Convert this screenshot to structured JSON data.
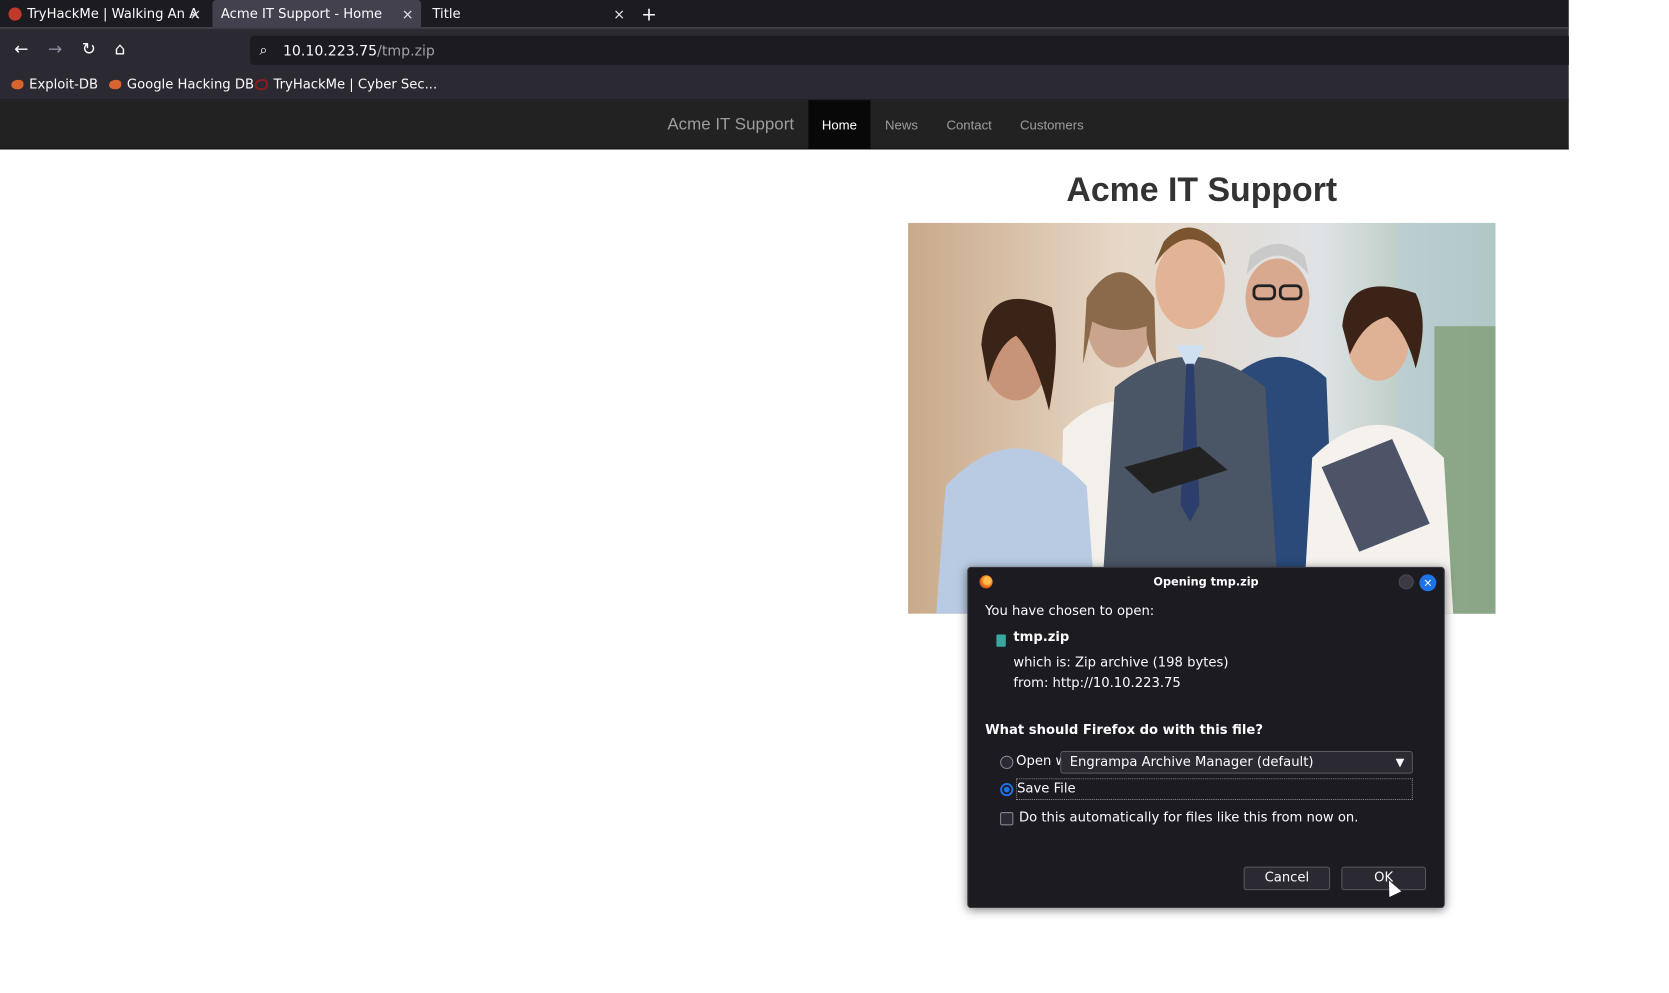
{
  "tabs": [
    {
      "title": "TryHackMe | Walking An A",
      "close": "×"
    },
    {
      "title": "Acme IT Support - Home",
      "close": "×"
    },
    {
      "title": "Title",
      "close": "×"
    }
  ],
  "newtab": "+",
  "nav": {
    "back": "←",
    "forward": "→",
    "reload": "↻",
    "home": "⌂",
    "search_glyph": "⌕",
    "url_host": "10.10.223.75",
    "url_path": "/tmp.zip"
  },
  "bookmarks": [
    {
      "label": "Exploit-DB",
      "icon": "exploitdb-icon"
    },
    {
      "label": "Google Hacking DB",
      "icon": "ghdb-icon"
    },
    {
      "label": "TryHackMe | Cyber Sec...",
      "icon": "tryhackme-icon"
    }
  ],
  "site": {
    "brand": "Acme IT Support",
    "nav": [
      "Home",
      "News",
      "Contact",
      "Customers"
    ],
    "heading": "Acme IT Support"
  },
  "dialog": {
    "title": "Opening tmp.zip",
    "close": "×",
    "intro": "You have chosen to open:",
    "filename": "tmp.zip",
    "which_is": "which is:  Zip archive (198 bytes)",
    "from": "from:  http://10.10.223.75",
    "question": "What should Firefox do with this file?",
    "open_with_label": "Open with",
    "open_with_app": "Engrampa Archive Manager (default)",
    "save_label": "Save File",
    "auto_label": "Do this automatically for files like this from now on.",
    "cancel": "Cancel",
    "ok": "OK",
    "selected": "save"
  }
}
